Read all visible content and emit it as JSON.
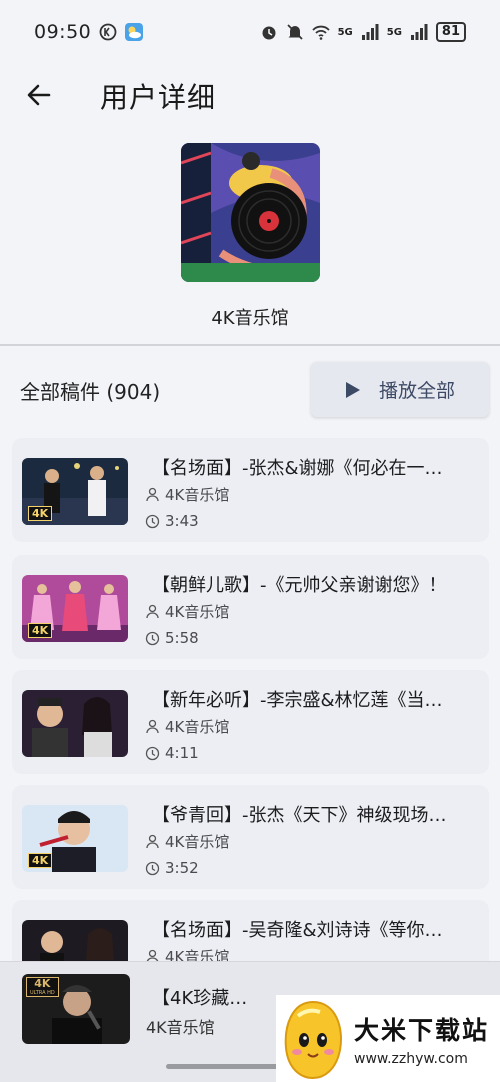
{
  "status_bar": {
    "time": "09:50",
    "battery": "81",
    "network_1": "5G",
    "network_2": "5G"
  },
  "app_bar": {
    "title": "用户详细"
  },
  "profile": {
    "name": "4K音乐馆"
  },
  "section": {
    "title": "全部稿件 (904)",
    "play_all": "播放全部"
  },
  "videos": [
    {
      "title": "【名场面】-张杰&谢娜《何必在一…",
      "author": "4K音乐馆",
      "duration": "3:43"
    },
    {
      "title": "【朝鲜儿歌】-《元帅父亲谢谢您》！",
      "author": "4K音乐馆",
      "duration": "5:58"
    },
    {
      "title": "【新年必听】-李宗盛&林忆莲《当…",
      "author": "4K音乐馆",
      "duration": "4:11"
    },
    {
      "title": "【爷青回】-张杰《天下》神级现场…",
      "author": "4K音乐馆",
      "duration": "3:52"
    },
    {
      "title": "【名场面】-吴奇隆&刘诗诗《等你…",
      "author": "4K音乐馆",
      "duration": ""
    }
  ],
  "badge": "4K",
  "mini_player": {
    "title": "【4K珍藏…",
    "artist": "4K音乐馆",
    "badge_top": "4K",
    "badge_bottom": "ULTRA HD"
  },
  "watermark": {
    "name": "大米下载站",
    "url": "www.zzhyw.com"
  },
  "colors": {
    "background": "#f3f4f8",
    "card": "#eceef3",
    "play_button": "#e6e8ef",
    "accent_text": "#3d4a66"
  }
}
